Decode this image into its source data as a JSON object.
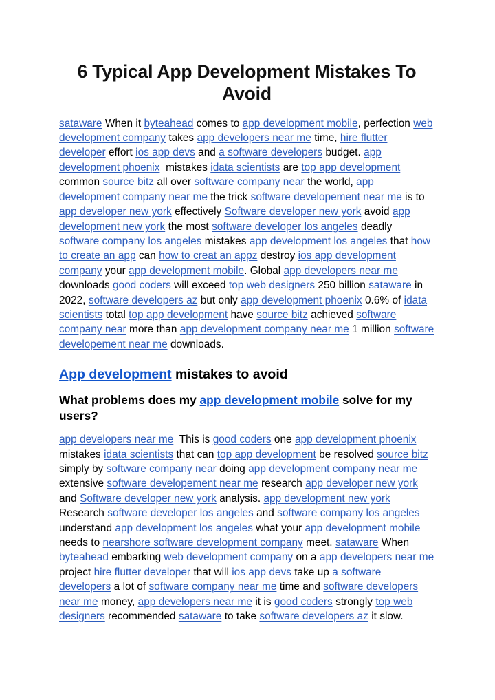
{
  "document": {
    "title": "6 Typical App Development Mistakes To Avoid",
    "link_color": "#2c5cbe",
    "heading_link_color": "#1155cc",
    "text_color": "#000000",
    "background_color": "#ffffff"
  },
  "paragraph_1": {
    "runs": [
      {
        "t": "sataware",
        "link": true
      },
      {
        "t": " When it ",
        "link": false
      },
      {
        "t": "byteahead",
        "link": true
      },
      {
        "t": " comes to ",
        "link": false
      },
      {
        "t": "app development mobile",
        "link": true
      },
      {
        "t": ", perfection ",
        "link": false
      },
      {
        "t": "web development company",
        "link": true
      },
      {
        "t": " takes ",
        "link": false
      },
      {
        "t": "app developers near me",
        "link": true
      },
      {
        "t": " time, ",
        "link": false
      },
      {
        "t": "hire flutter developer",
        "link": true
      },
      {
        "t": " effort ",
        "link": false
      },
      {
        "t": "ios app devs",
        "link": true
      },
      {
        "t": " and ",
        "link": false
      },
      {
        "t": "a software developers",
        "link": true
      },
      {
        "t": " budget. ",
        "link": false
      },
      {
        "t": "app development phoenix",
        "link": true
      },
      {
        "t": "  mistakes ",
        "link": false
      },
      {
        "t": "idata scientists",
        "link": true
      },
      {
        "t": " are ",
        "link": false
      },
      {
        "t": "top app development",
        "link": true
      },
      {
        "t": " common ",
        "link": false
      },
      {
        "t": "source bitz",
        "link": true
      },
      {
        "t": " all over ",
        "link": false
      },
      {
        "t": "software company near",
        "link": true
      },
      {
        "t": " the world, ",
        "link": false
      },
      {
        "t": "app development company near me",
        "link": true
      },
      {
        "t": " the trick ",
        "link": false
      },
      {
        "t": "software developement near me",
        "link": true
      },
      {
        "t": " is to ",
        "link": false
      },
      {
        "t": "app developer new york",
        "link": true
      },
      {
        "t": " effectively ",
        "link": false
      },
      {
        "t": "Software developer new york",
        "link": true
      },
      {
        "t": " avoid ",
        "link": false
      },
      {
        "t": "app development new york",
        "link": true
      },
      {
        "t": " the most ",
        "link": false
      },
      {
        "t": "software developer los angeles",
        "link": true
      },
      {
        "t": " deadly ",
        "link": false
      },
      {
        "t": "software company los angeles",
        "link": true
      },
      {
        "t": " mistakes ",
        "link": false
      },
      {
        "t": "app development los angeles",
        "link": true
      },
      {
        "t": " that ",
        "link": false
      },
      {
        "t": "how to create an app",
        "link": true
      },
      {
        "t": " can ",
        "link": false
      },
      {
        "t": "how to creat an appz",
        "link": true
      },
      {
        "t": " destroy ",
        "link": false
      },
      {
        "t": "ios app development company",
        "link": true
      },
      {
        "t": " your ",
        "link": false
      },
      {
        "t": "app development mobile",
        "link": true
      },
      {
        "t": ". Global ",
        "link": false
      },
      {
        "t": "app developers near me",
        "link": true
      },
      {
        "t": " downloads ",
        "link": false
      },
      {
        "t": "good coders",
        "link": true
      },
      {
        "t": " will exceed ",
        "link": false
      },
      {
        "t": "top web designers",
        "link": true
      },
      {
        "t": " 250 billion ",
        "link": false
      },
      {
        "t": "sataware",
        "link": true
      },
      {
        "t": " in 2022, ",
        "link": false
      },
      {
        "t": "software developers az",
        "link": true
      },
      {
        "t": " but only ",
        "link": false
      },
      {
        "t": "app development phoenix",
        "link": true
      },
      {
        "t": " 0.6% of ",
        "link": false
      },
      {
        "t": "idata scientists",
        "link": true
      },
      {
        "t": " total ",
        "link": false
      },
      {
        "t": "top app development",
        "link": true
      },
      {
        "t": " have ",
        "link": false
      },
      {
        "t": "source bitz",
        "link": true
      },
      {
        "t": " achieved ",
        "link": false
      },
      {
        "t": "software company near",
        "link": true
      },
      {
        "t": " more than ",
        "link": false
      },
      {
        "t": "app development company near me",
        "link": true
      },
      {
        "t": " 1 million ",
        "link": false
      },
      {
        "t": "software developement near me",
        "link": true
      },
      {
        "t": " downloads.",
        "link": false
      }
    ]
  },
  "heading_2": {
    "runs": [
      {
        "t": "App development",
        "link": true
      },
      {
        "t": " mistakes to avoid",
        "link": false
      }
    ]
  },
  "heading_3": {
    "runs": [
      {
        "t": "What problems does my ",
        "link": false
      },
      {
        "t": "app development mobile",
        "link": true
      },
      {
        "t": " solve for my users?",
        "link": false
      }
    ]
  },
  "paragraph_2": {
    "runs": [
      {
        "t": "app developers near me",
        "link": true
      },
      {
        "t": "  This is ",
        "link": false
      },
      {
        "t": "good coders",
        "link": true
      },
      {
        "t": " one ",
        "link": false
      },
      {
        "t": "app development phoenix",
        "link": true
      },
      {
        "t": " mistakes ",
        "link": false
      },
      {
        "t": "idata scientists",
        "link": true
      },
      {
        "t": " that can ",
        "link": false
      },
      {
        "t": "top app development",
        "link": true
      },
      {
        "t": " be resolved ",
        "link": false
      },
      {
        "t": "source bitz",
        "link": true
      },
      {
        "t": " simply by ",
        "link": false
      },
      {
        "t": "software company near",
        "link": true
      },
      {
        "t": " doing ",
        "link": false
      },
      {
        "t": "app development company near me",
        "link": true
      },
      {
        "t": " extensive ",
        "link": false
      },
      {
        "t": "software developement near me",
        "link": true
      },
      {
        "t": " research ",
        "link": false
      },
      {
        "t": "app developer new york",
        "link": true
      },
      {
        "t": " and ",
        "link": false
      },
      {
        "t": "Software developer new york",
        "link": true
      },
      {
        "t": " analysis. ",
        "link": false
      },
      {
        "t": "app development new york",
        "link": true
      },
      {
        "t": " Research ",
        "link": false
      },
      {
        "t": "software developer los angeles",
        "link": true
      },
      {
        "t": " and ",
        "link": false
      },
      {
        "t": "software company los angeles",
        "link": true
      },
      {
        "t": " understand ",
        "link": false
      },
      {
        "t": "app development los angeles",
        "link": true
      },
      {
        "t": " what your ",
        "link": false
      },
      {
        "t": "app development mobile",
        "link": true
      },
      {
        "t": " needs to ",
        "link": false
      },
      {
        "t": "nearshore software development company",
        "link": true
      },
      {
        "t": " meet. ",
        "link": false
      },
      {
        "t": "sataware",
        "link": true
      },
      {
        "t": " When ",
        "link": false
      },
      {
        "t": "byteahead",
        "link": true
      },
      {
        "t": " embarking ",
        "link": false
      },
      {
        "t": "web development company",
        "link": true
      },
      {
        "t": " on a ",
        "link": false
      },
      {
        "t": "app developers near me",
        "link": true
      },
      {
        "t": " project ",
        "link": false
      },
      {
        "t": "hire flutter developer",
        "link": true
      },
      {
        "t": " that will ",
        "link": false
      },
      {
        "t": "ios app devs",
        "link": true
      },
      {
        "t": " take up ",
        "link": false
      },
      {
        "t": "a software developers",
        "link": true
      },
      {
        "t": " a lot of ",
        "link": false
      },
      {
        "t": "software company near me",
        "link": true
      },
      {
        "t": " time and ",
        "link": false
      },
      {
        "t": "software developers near me",
        "link": true
      },
      {
        "t": " money, ",
        "link": false
      },
      {
        "t": "app developers near me",
        "link": true
      },
      {
        "t": " it is ",
        "link": false
      },
      {
        "t": "good coders",
        "link": true
      },
      {
        "t": " strongly ",
        "link": false
      },
      {
        "t": "top web designers",
        "link": true
      },
      {
        "t": " recommended ",
        "link": false
      },
      {
        "t": "sataware",
        "link": true
      },
      {
        "t": " to take ",
        "link": false
      },
      {
        "t": "software developers az",
        "link": true
      },
      {
        "t": " it slow.",
        "link": false
      }
    ]
  }
}
